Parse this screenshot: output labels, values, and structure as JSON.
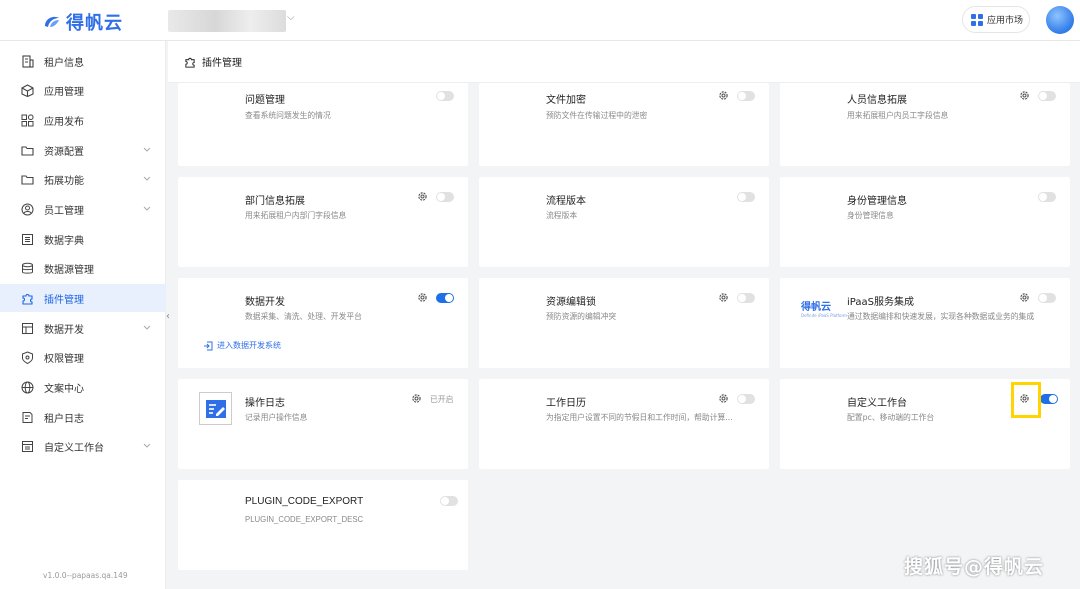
{
  "topbar": {
    "logo_text": "得帆云",
    "app_market_label": "应用市场"
  },
  "sidebar": {
    "items": [
      {
        "label": "租户信息",
        "icon": "building-icon",
        "expandable": false
      },
      {
        "label": "应用管理",
        "icon": "cube-icon",
        "expandable": false
      },
      {
        "label": "应用发布",
        "icon": "grid-icon",
        "expandable": false
      },
      {
        "label": "资源配置",
        "icon": "folder-icon",
        "expandable": true
      },
      {
        "label": "拓展功能",
        "icon": "folder-icon",
        "expandable": true
      },
      {
        "label": "员工管理",
        "icon": "user-circle-icon",
        "expandable": true
      },
      {
        "label": "数据字典",
        "icon": "list-icon",
        "expandable": false
      },
      {
        "label": "数据源管理",
        "icon": "database-icon",
        "expandable": false
      },
      {
        "label": "插件管理",
        "icon": "puzzle-icon",
        "expandable": false,
        "active": true
      },
      {
        "label": "数据开发",
        "icon": "dataflow-icon",
        "expandable": true
      },
      {
        "label": "权限管理",
        "icon": "shield-icon",
        "expandable": false
      },
      {
        "label": "文案中心",
        "icon": "globe-icon",
        "expandable": false
      },
      {
        "label": "租户日志",
        "icon": "log-icon",
        "expandable": false
      },
      {
        "label": "自定义工作台",
        "icon": "workbench-icon",
        "expandable": true
      }
    ],
    "version": "v1.0.0--papaas.qa.149"
  },
  "page": {
    "title": "插件管理"
  },
  "plugins": [
    {
      "title": "问题管理",
      "desc": "查看系统问题发生的情况",
      "gear": false,
      "enabled": false
    },
    {
      "title": "文件加密",
      "desc": "预防文件在传输过程中的泄密",
      "gear": true,
      "enabled": false
    },
    {
      "title": "人员信息拓展",
      "desc": "用来拓展租户内员工字段信息",
      "gear": true,
      "enabled": false
    },
    {
      "title": "部门信息拓展",
      "desc": "用来拓展租户内部门字段信息",
      "gear": true,
      "enabled": false
    },
    {
      "title": "流程版本",
      "desc": "流程版本",
      "gear": false,
      "enabled": false
    },
    {
      "title": "身份管理信息",
      "desc": "身份管理信息",
      "gear": false,
      "enabled": false
    },
    {
      "title": "数据开发",
      "desc": "数据采集、清洗、处理、开发平台",
      "gear": true,
      "enabled": true,
      "link": "进入数据开发系统"
    },
    {
      "title": "资源编辑锁",
      "desc": "预防资源的编辑冲突",
      "gear": true,
      "enabled": false
    },
    {
      "title": "iPaaS服务集成",
      "desc": "通过数据编排和快速发展，实现各种数据或业务的集成",
      "gear": true,
      "enabled": false,
      "logo_text": "得帆云",
      "logo_sub": "Definite iPaaS Platform"
    },
    {
      "title": "操作日志",
      "desc": "记录用户操作信息",
      "gear": true,
      "status_text": "已开启"
    },
    {
      "title": "工作日历",
      "desc": "为指定用户设置不同的节假日和工作时间，帮助计算...",
      "gear": true,
      "enabled": false
    },
    {
      "title": "自定义工作台",
      "desc": "配置pc、移动端的工作台",
      "gear": true,
      "enabled": true
    },
    {
      "title": "PLUGIN_CODE_EXPORT",
      "desc": "PLUGIN_CODE_EXPORT_DESC",
      "gear": false,
      "enabled": false
    }
  ],
  "watermark": "搜狐号@得帆云",
  "colors": {
    "accent": "#1f6fe8",
    "highlight": "#ffd400"
  }
}
